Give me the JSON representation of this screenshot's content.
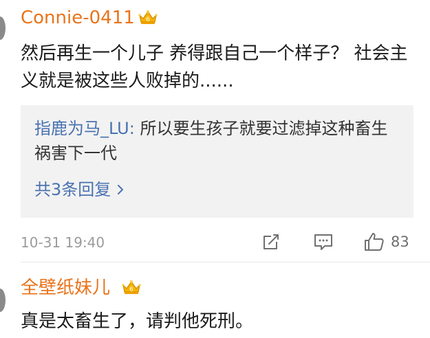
{
  "comment1": {
    "username": "Connie-0411",
    "text": "然后再生一个儿子 养得跟自己一个样子？ 社会主义就是被这些人败掉的......",
    "reply": {
      "username": "指鹿为马_LU",
      "separator": ":",
      "text": " 所以要生孩子就要过滤掉这种畜生  祸害下一代"
    },
    "more_replies": "共3条回复",
    "timestamp": "10-31 19:40",
    "likes": "83"
  },
  "comment2": {
    "username": "全壁纸妹儿",
    "text": "真是太畜生了，请判他死刑。"
  },
  "colors": {
    "username": "#e8741c",
    "link": "#4a72b0",
    "crown": "#f5b400",
    "meta": "#9b9b9b"
  }
}
